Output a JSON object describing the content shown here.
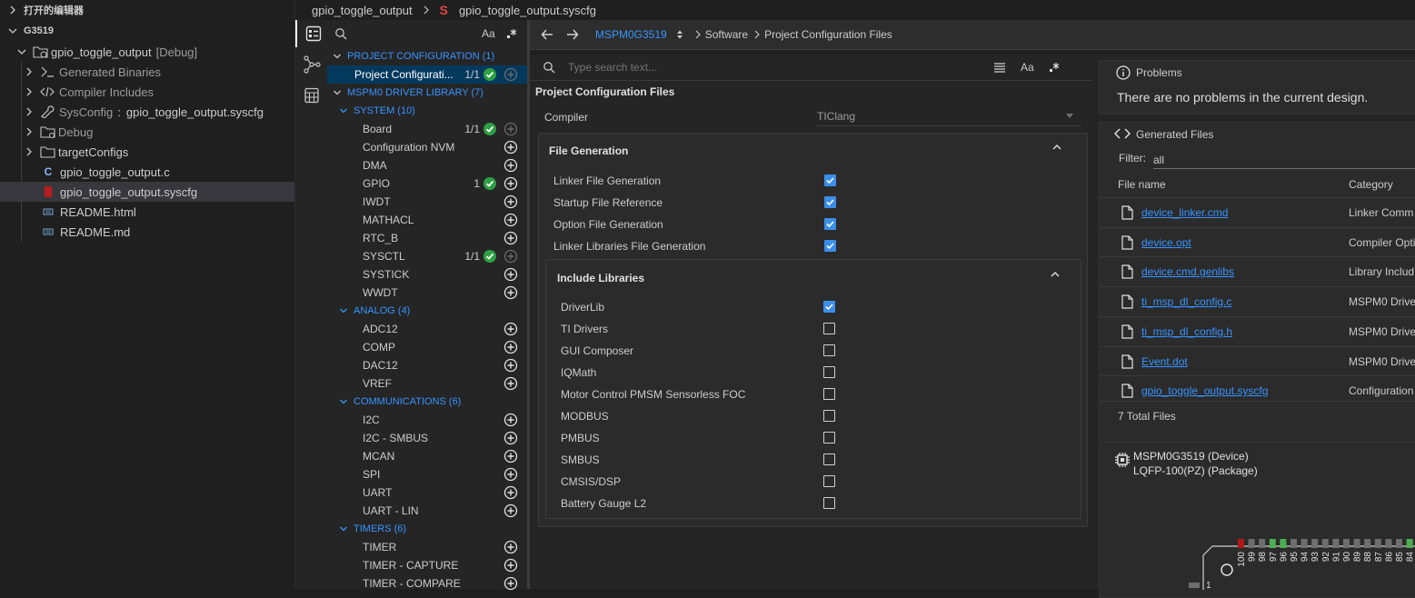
{
  "explorer": {
    "open_editors": "打开的编辑器",
    "workspace": "G3519",
    "project": {
      "name": "gpio_toggle_output",
      "tag": "[Debug]"
    },
    "items": [
      {
        "label": "Generated Binaries",
        "icon": "binary-icon"
      },
      {
        "label": "Compiler Includes",
        "icon": "code-icon"
      },
      {
        "label": "SysConfig",
        "sep": ":",
        "value": "gpio_toggle_output.syscfg",
        "icon": "wrench-icon"
      },
      {
        "label": "Debug",
        "icon": "folder-icon"
      },
      {
        "label": "targetConfigs",
        "icon": "folder-icon"
      },
      {
        "label": "gpio_toggle_output.c",
        "icon": "c-file-icon"
      },
      {
        "label": "gpio_toggle_output.syscfg",
        "icon": "syscfg-file-icon"
      },
      {
        "label": "README.html",
        "icon": "html-file-icon"
      },
      {
        "label": "README.md",
        "icon": "md-file-icon"
      }
    ]
  },
  "breadcrumb": {
    "folder": "gpio_toggle_output",
    "file": "gpio_toggle_output.syscfg"
  },
  "modules": {
    "search_case": "Aa",
    "project_config_header": "PROJECT CONFIGURATION (1)",
    "project_config_item": "Project Configurati...",
    "project_config_count": "1/1",
    "driver_header": "MSPM0 DRIVER LIBRARY (7)",
    "system": {
      "header": "SYSTEM (10)",
      "items": [
        {
          "label": "Board",
          "count": "1/1",
          "status": "ok"
        },
        {
          "label": "Configuration NVM",
          "count": "",
          "status": ""
        },
        {
          "label": "DMA",
          "count": "",
          "status": ""
        },
        {
          "label": "GPIO",
          "count": "1",
          "status": "ok"
        },
        {
          "label": "IWDT",
          "count": "",
          "status": ""
        },
        {
          "label": "MATHACL",
          "count": "",
          "status": ""
        },
        {
          "label": "RTC_B",
          "count": "",
          "status": ""
        },
        {
          "label": "SYSCTL",
          "count": "1/1",
          "status": "ok"
        },
        {
          "label": "SYSTICK",
          "count": "",
          "status": ""
        },
        {
          "label": "WWDT",
          "count": "",
          "status": ""
        }
      ]
    },
    "analog": {
      "header": "ANALOG (4)",
      "items": [
        "ADC12",
        "COMP",
        "DAC12",
        "VREF"
      ]
    },
    "communications": {
      "header": "COMMUNICATIONS (6)",
      "items": [
        "I2C",
        "I2C - SMBUS",
        "MCAN",
        "SPI",
        "UART",
        "UART - LIN"
      ]
    },
    "timers": {
      "header": "TIMERS (6)",
      "items": [
        "TIMER",
        "TIMER - CAPTURE",
        "TIMER - COMPARE"
      ]
    }
  },
  "nav": {
    "device": "MSPM0G3519",
    "crumb1": "Software",
    "crumb2": "Project Configuration Files"
  },
  "config": {
    "search_placeholder": "Type search text...",
    "case_label": "Aa",
    "title": "Project Configuration Files",
    "compiler_label": "Compiler",
    "compiler_value": "TIClang",
    "file_generation": {
      "title": "File Generation",
      "options": [
        {
          "label": "Linker File Generation",
          "checked": true
        },
        {
          "label": "Startup File Reference",
          "checked": true
        },
        {
          "label": "Option File Generation",
          "checked": true
        },
        {
          "label": "Linker Libraries File Generation",
          "checked": true
        }
      ]
    },
    "include_libraries": {
      "title": "Include Libraries",
      "options": [
        {
          "label": "DriverLib",
          "checked": true
        },
        {
          "label": "TI Drivers",
          "checked": false
        },
        {
          "label": "GUI Composer",
          "checked": false
        },
        {
          "label": "IQMath",
          "checked": false
        },
        {
          "label": "Motor Control PMSM Sensorless FOC",
          "checked": false
        },
        {
          "label": "MODBUS",
          "checked": false
        },
        {
          "label": "PMBUS",
          "checked": false
        },
        {
          "label": "SMBUS",
          "checked": false
        },
        {
          "label": "CMSIS/DSP",
          "checked": false
        },
        {
          "label": "Battery Gauge L2",
          "checked": false
        }
      ]
    }
  },
  "problems": {
    "title": "Problems",
    "message": "There are no problems in the current design."
  },
  "generated": {
    "title": "Generated Files",
    "filter_label": "Filter:",
    "filter_value": "all",
    "col_name": "File name",
    "col_category": "Category",
    "files": [
      {
        "name": "device_linker.cmd",
        "category": "Linker Comm"
      },
      {
        "name": "device.opt",
        "category": "Compiler Opti"
      },
      {
        "name": "device.cmd.genlibs",
        "category": "Library Includ"
      },
      {
        "name": "ti_msp_dl_config.c",
        "category": "MSPM0 Drive"
      },
      {
        "name": "ti_msp_dl_config.h",
        "category": "MSPM0 Drive"
      },
      {
        "name": "Event.dot",
        "category": "MSPM0 Drive"
      },
      {
        "name": "gpio_toggle_output.syscfg",
        "category": "Configuration"
      }
    ],
    "total": "7 Total Files"
  },
  "device": {
    "device_line": "MSPM0G3519 (Device)",
    "package_line": "LQFP-100(PZ) (Package)",
    "pins": [
      "100",
      "99",
      "98",
      "97",
      "96",
      "95",
      "94",
      "93",
      "92",
      "91",
      "90",
      "89",
      "88",
      "87",
      "86",
      "85",
      "84"
    ],
    "pin_colors": [
      "#b01818",
      "#6e6e6e",
      "#6e6e6e",
      "#4caf50",
      "#4caf50",
      "#6e6e6e",
      "#6e6e6e",
      "#6e6e6e",
      "#6e6e6e",
      "#6e6e6e",
      "#6e6e6e",
      "#6e6e6e",
      "#6e6e6e",
      "#6e6e6e",
      "#6e6e6e",
      "#6e6e6e",
      "#4caf50"
    ],
    "left_pin": "1"
  },
  "colors": {
    "accent": "#3794ff",
    "ok": "#2ea043",
    "checkbox": "#3b8eea"
  }
}
